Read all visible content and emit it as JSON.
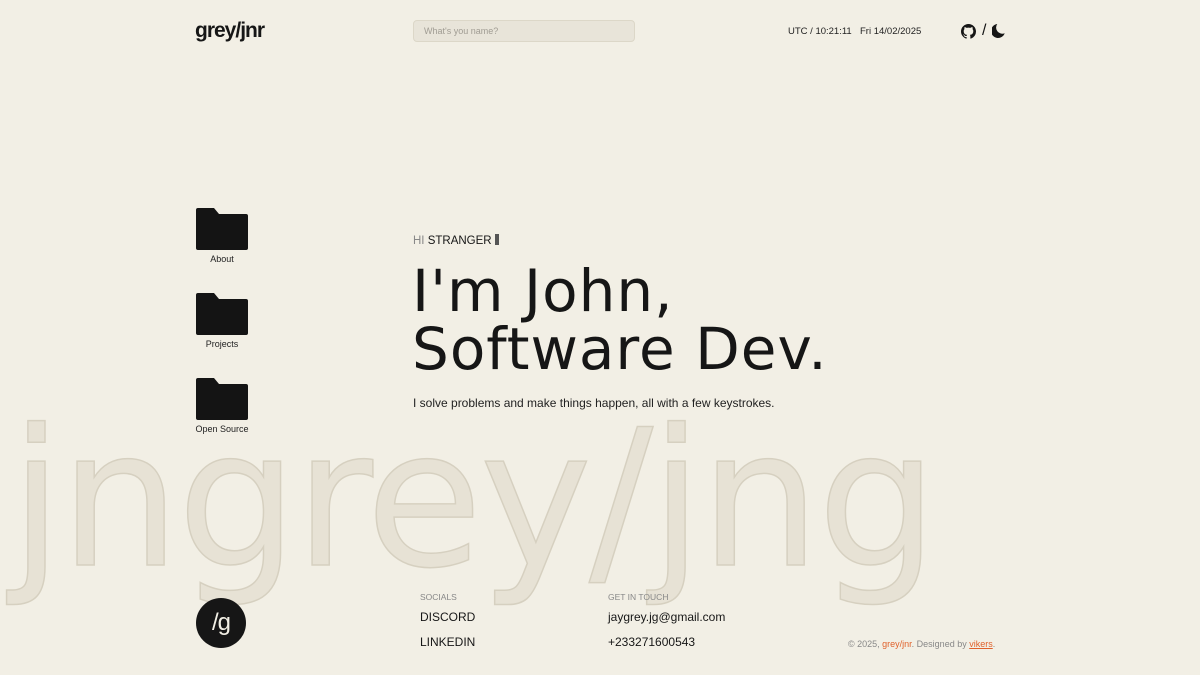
{
  "watermark": "jngrey/jng",
  "header": {
    "logo": "grey/jnr",
    "name_placeholder": "What's you name?",
    "clock": "UTC / 10:21:11",
    "date": "Fri 14/02/2025",
    "separator": "/"
  },
  "folders": [
    {
      "label": "About"
    },
    {
      "label": "Projects"
    },
    {
      "label": "Open Source"
    }
  ],
  "hero": {
    "hi": "HI",
    "name": "STRANGER",
    "line1": "I'm John,",
    "line2": "Software Dev.",
    "tagline": "I solve problems and make things happen, all with a few keystrokes."
  },
  "badge": "/g",
  "socials": {
    "heading": "SOCIALS",
    "items": [
      "DISCORD",
      "LINKEDIN"
    ]
  },
  "contact": {
    "heading": "GET IN TOUCH",
    "email": "jaygrey.jg@gmail.com",
    "phone": "+233271600543"
  },
  "footer": {
    "prefix": "© 2025, ",
    "brand": "grey/jnr",
    "middle": ". Designed by ",
    "designer": "vikers",
    "suffix": "."
  },
  "colors": {
    "background": "#f2efe5",
    "accent": "#e0622c",
    "text": "#161616"
  }
}
